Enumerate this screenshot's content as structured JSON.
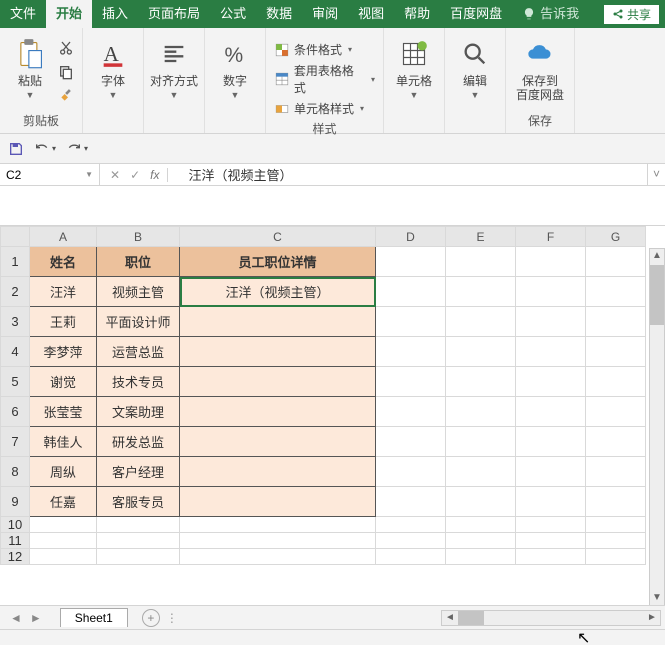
{
  "tabs": {
    "file": "文件",
    "home": "开始",
    "insert": "插入",
    "layout": "页面布局",
    "formulas": "公式",
    "data": "数据",
    "review": "审阅",
    "view": "视图",
    "help": "帮助",
    "baidu": "百度网盘",
    "tell": "告诉我"
  },
  "share": "共享",
  "ribbon": {
    "clipboard": {
      "paste": "粘贴",
      "label": "剪贴板"
    },
    "font": {
      "btn": "字体"
    },
    "align": {
      "btn": "对齐方式"
    },
    "number": {
      "btn": "数字"
    },
    "styles": {
      "condfmt": "条件格式",
      "tablefmt": "套用表格格式",
      "cellstyle": "单元格样式",
      "label": "样式"
    },
    "cells": {
      "btn": "单元格"
    },
    "edit": {
      "btn": "编辑"
    },
    "save": {
      "btn": "保存到",
      "btn2": "百度网盘",
      "label": "保存"
    }
  },
  "namebox": "C2",
  "formula": "汪洋（视频主管）",
  "columns": [
    "A",
    "B",
    "C",
    "D",
    "E",
    "F",
    "G"
  ],
  "rows": [
    "1",
    "2",
    "3",
    "4",
    "5",
    "6",
    "7",
    "8",
    "9",
    "10",
    "11",
    "12"
  ],
  "chart_data": {
    "type": "table",
    "headers": [
      "姓名",
      "职位",
      "员工职位详情"
    ],
    "rows": [
      [
        "汪洋",
        "视频主管",
        "汪洋（视频主管）"
      ],
      [
        "王莉",
        "平面设计师",
        ""
      ],
      [
        "李梦萍",
        "运营总监",
        ""
      ],
      [
        "谢觉",
        "技术专员",
        ""
      ],
      [
        "张莹莹",
        "文案助理",
        ""
      ],
      [
        "韩佳人",
        "研发总监",
        ""
      ],
      [
        "周纵",
        "客户经理",
        ""
      ],
      [
        "任嘉",
        "客服专员",
        ""
      ]
    ]
  },
  "sheet": "Sheet1"
}
